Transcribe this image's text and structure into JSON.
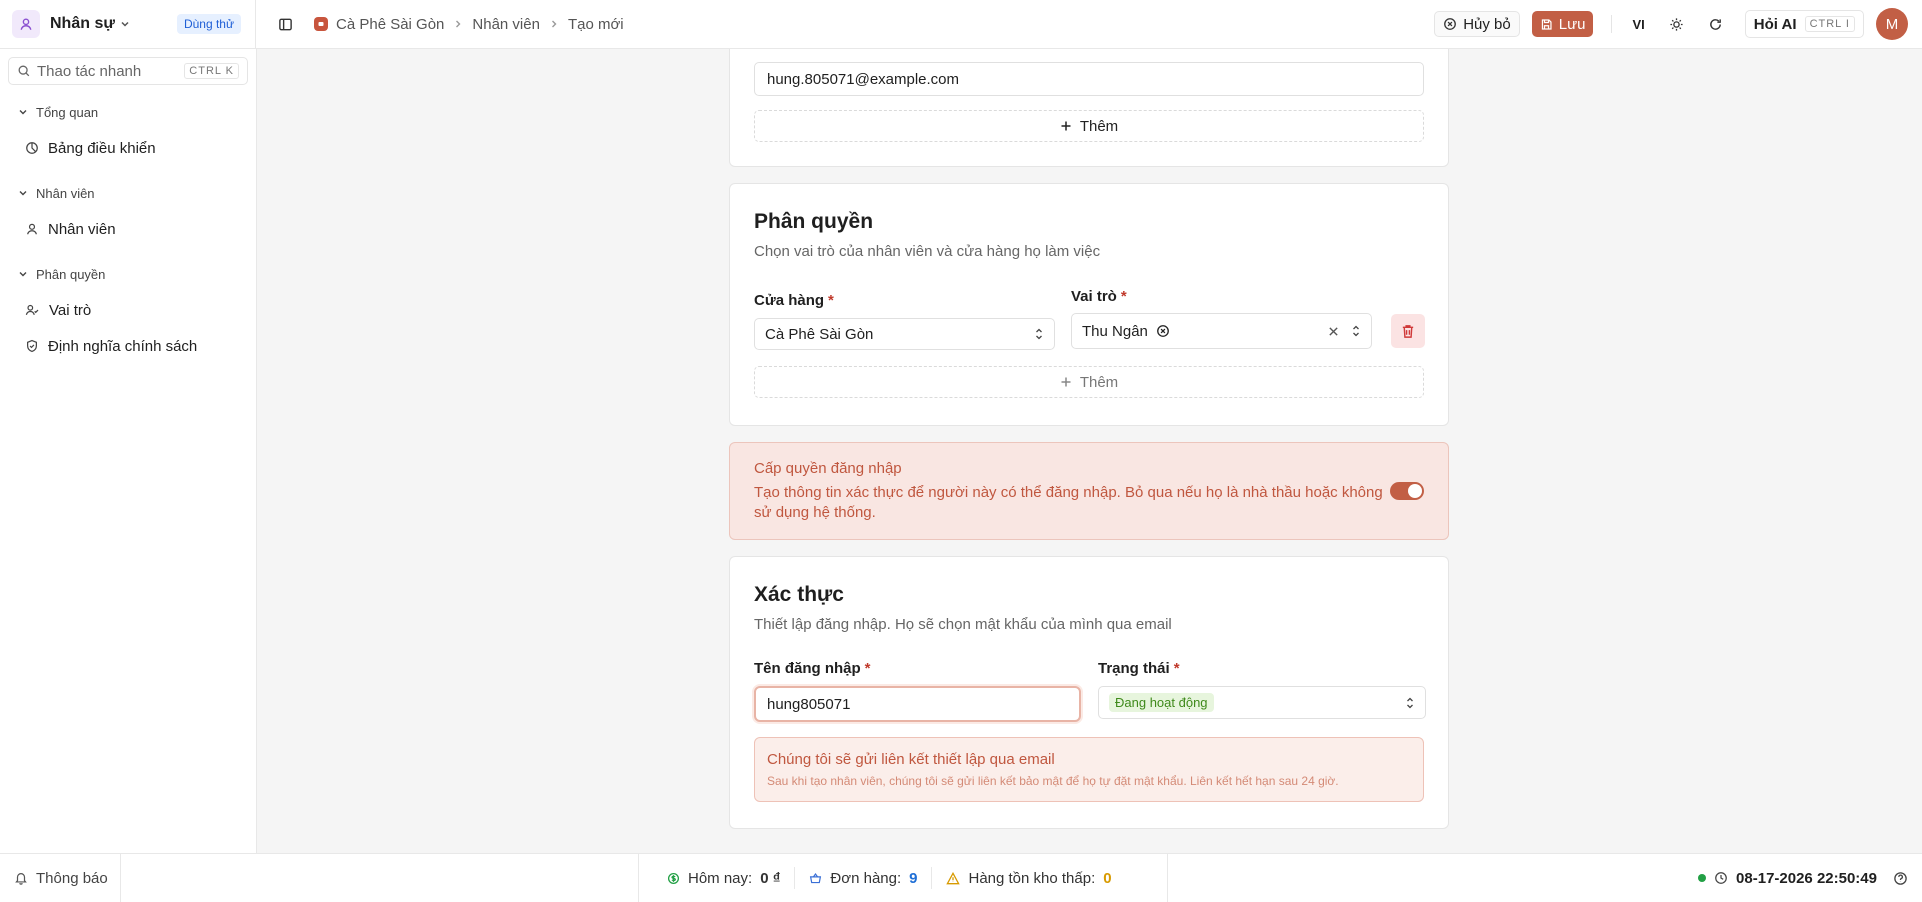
{
  "header": {
    "app_name": "Nhân sự",
    "trial_badge": "Dùng thử",
    "breadcrumb": [
      "Cà Phê Sài Gòn",
      "Nhân viên",
      "Tạo mới"
    ],
    "cancel_label": "Hủy bỏ",
    "save_label": "Lưu",
    "language": "VI",
    "ask_ai_label": "Hỏi AI",
    "ask_ai_shortcut": "CTRL I",
    "avatar_initial": "M"
  },
  "sidebar": {
    "search_placeholder": "Thao tác nhanh",
    "search_shortcut": "CTRL K",
    "groups": [
      {
        "title": "Tổng quan",
        "items": [
          {
            "label": "Bảng điều khiển",
            "icon": "pie-chart-icon"
          }
        ]
      },
      {
        "title": "Nhân viên",
        "items": [
          {
            "label": "Nhân viên",
            "icon": "user-icon"
          }
        ]
      },
      {
        "title": "Phân quyền",
        "items": [
          {
            "label": "Vai trò",
            "icon": "users-role-icon"
          },
          {
            "label": "Định nghĩa chính sách",
            "icon": "shield-icon"
          }
        ]
      }
    ]
  },
  "email_section": {
    "email_value": "hung.805071@example.com",
    "add_label": "Thêm"
  },
  "permission_section": {
    "title": "Phân quyền",
    "subtitle": "Chọn vai trò của nhân viên và cửa hàng họ làm việc",
    "store_label": "Cửa hàng",
    "store_value": "Cà Phê Sài Gòn",
    "role_label": "Vai trò",
    "role_tag": "Thu Ngân",
    "add_label": "Thêm",
    "required_mark": "*"
  },
  "login_section": {
    "title": "Cấp quyền đăng nhập",
    "description": "Tạo thông tin xác thực để người này có thể đăng nhập. Bỏ qua nếu họ là nhà thầu hoặc không sử dụng hệ thống.",
    "enabled": true
  },
  "auth_section": {
    "title": "Xác thực",
    "subtitle": "Thiết lập đăng nhập. Họ sẽ chọn mật khẩu của mình qua email",
    "username_label": "Tên đăng nhập",
    "username_value": "hung805071",
    "status_label": "Trạng thái",
    "status_value": "Đang hoạt động",
    "info_title": "Chúng tôi sẽ gửi liên kết thiết lập qua email",
    "info_description": "Sau khi tạo nhân viên, chúng tôi sẽ gửi liên kết bảo mật để họ tự đặt mật khẩu. Liên kết hết hạn sau 24 giờ."
  },
  "footer": {
    "notifications_label": "Thông báo",
    "today_label": "Hôm nay:",
    "today_value": "0 ₫",
    "orders_label": "Đơn hàng:",
    "orders_value": "9",
    "low_stock_label": "Hàng tồn kho thấp:",
    "low_stock_value": "0",
    "datetime": "08-17-2026 22:50:49"
  },
  "colors": {
    "accent": "#c25f45",
    "orders_value": "#1f6fd6",
    "low_stock_value": "#d89a00",
    "status_green": "#3f8a1b"
  }
}
